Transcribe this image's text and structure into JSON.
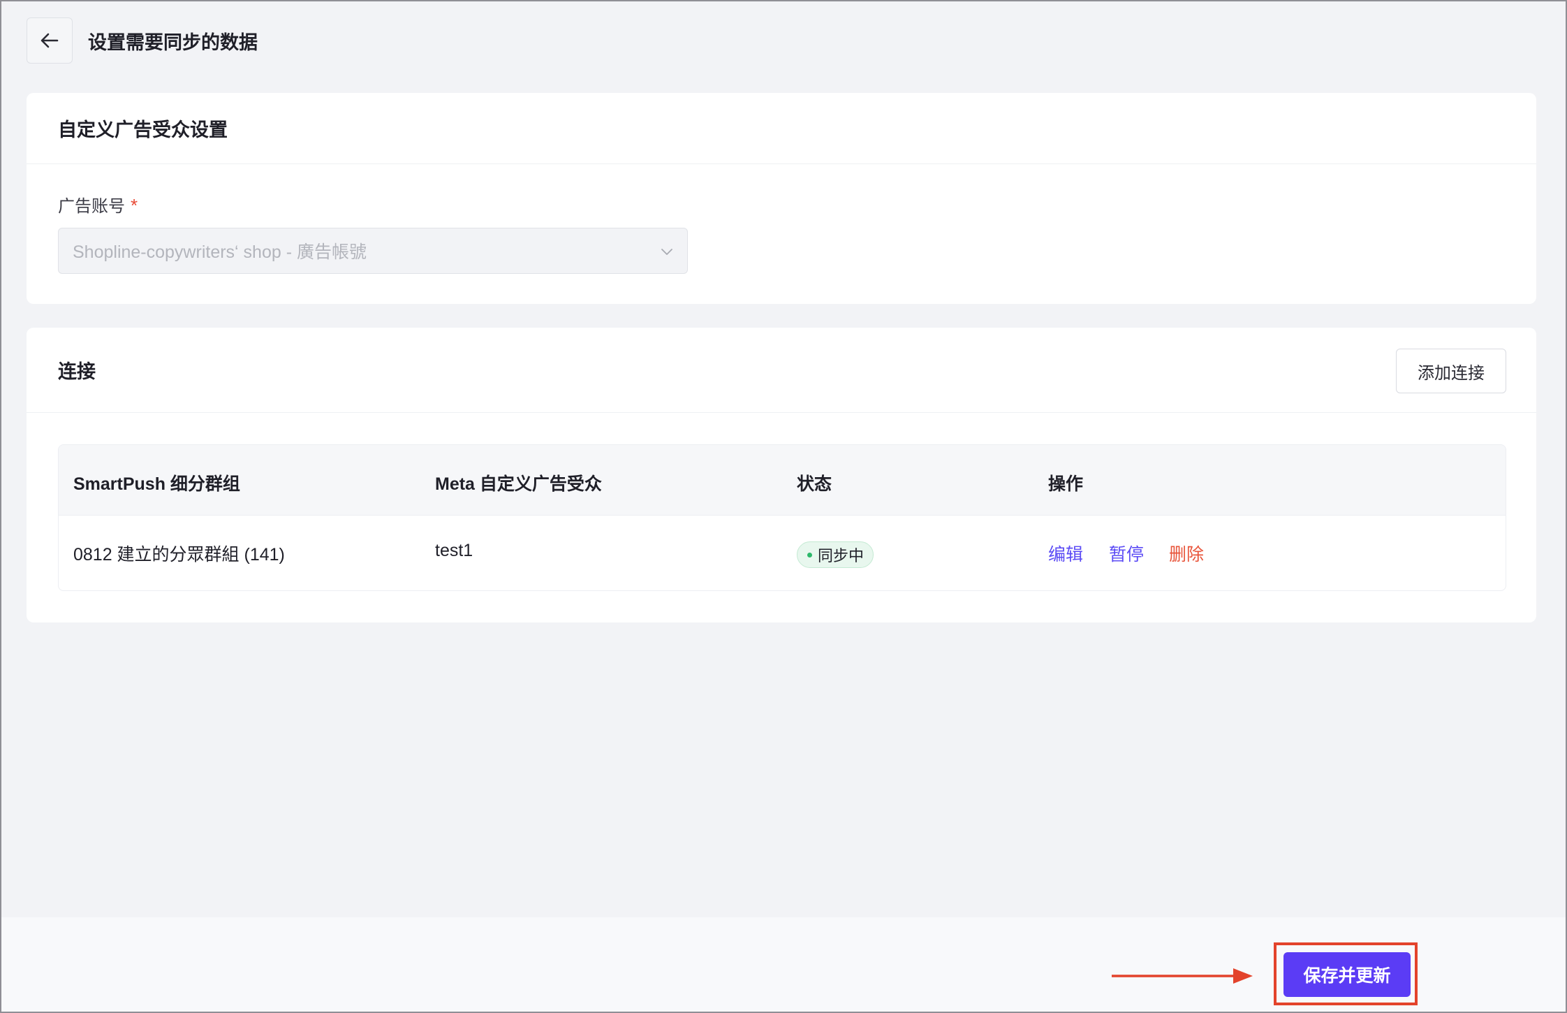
{
  "header": {
    "back_icon": "arrow-left-icon",
    "title": "设置需要同步的数据"
  },
  "audience_card": {
    "title": "自定义广告受众设置",
    "ad_account_label": "广告账号",
    "required_mark": "*",
    "ad_account_value": "Shopline-copywriters‘ shop - 廣告帳號",
    "chevron_icon": "chevron-down-icon"
  },
  "connections_card": {
    "title": "连接",
    "add_button": "添加连接",
    "columns": [
      "SmartPush 细分群组",
      "Meta 自定义广告受众",
      "状态",
      "操作"
    ],
    "rows": [
      {
        "segment": "0812 建立的分眾群組 (141)",
        "audience": "test1",
        "status": "同步中",
        "actions": {
          "edit": "编辑",
          "pause": "暂停",
          "delete": "删除"
        }
      }
    ]
  },
  "footer": {
    "save_button": "保存并更新"
  },
  "colors": {
    "primary": "#5b3cf5",
    "danger": "#e8543a",
    "success": "#2db86a",
    "annotation": "#e3432b"
  }
}
